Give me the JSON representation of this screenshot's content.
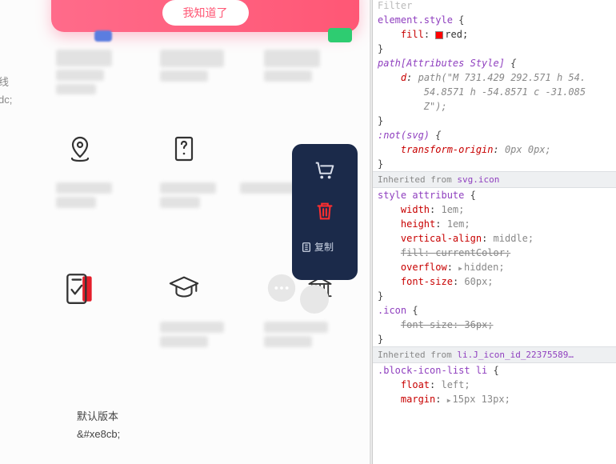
{
  "banner": {
    "button_label": "我知道了"
  },
  "edge": {
    "line1": "线",
    "line2": "dc;"
  },
  "meta": {
    "label1": "默认版本",
    "label2": "&#xe8cb;"
  },
  "dark_panel": {
    "copy_label": "复制"
  },
  "inspector": {
    "filter_placeholder": "Filter",
    "block_elementstyle": {
      "selector": "element.style",
      "rule_prop": "fill",
      "rule_value": "red"
    },
    "block_path": {
      "selector": "path[Attributes Style]",
      "prop": "d",
      "value_l1": "path(\"M 731.429 292.571 h 54.",
      "value_l2": "54.8571 h -54.8571 c -31.085",
      "value_l3": "Z\");"
    },
    "block_notsvg": {
      "selector": ":not(svg)",
      "prop": "transform-origin",
      "value": "0px 0px;"
    },
    "inherit1_label": "Inherited from ",
    "inherit1_source": "svg.icon",
    "style_attribute": {
      "selector": "style attribute",
      "r_width": "1em;",
      "r_height": "1em;",
      "r_valign": "middle;",
      "r_fill": "currentColor;",
      "r_overflow": "hidden;",
      "r_fontsize": "60px;"
    },
    "icon_class": {
      "selector": ".icon",
      "r_fontsize": "36px;"
    },
    "inherit2_label": "Inherited from ",
    "inherit2_source": "li.J_icon_id_22375589…",
    "block_li": {
      "selector": ".block-icon-list li",
      "r_float": "left;",
      "r_margin": "15px 13px;"
    }
  }
}
